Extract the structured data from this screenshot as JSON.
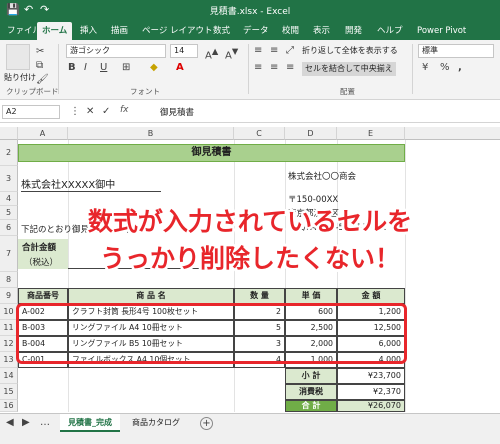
{
  "titlebar": {
    "title": "見積書.xlsx  -  Excel",
    "save_icon": "💾",
    "undo_icon": "↶",
    "redo_icon": "↷"
  },
  "menu": {
    "tabs": [
      "ファイル",
      "ホーム",
      "挿入",
      "描画",
      "ページ レイアウト",
      "数式",
      "データ",
      "校閲",
      "表示",
      "開発",
      "ヘルプ",
      "Power Pivot"
    ]
  },
  "ribbon": {
    "clipboard": {
      "paste_label": "貼り付け",
      "group_label": "クリップボード"
    },
    "font": {
      "font_name": "游ゴシック",
      "font_size": "14",
      "bold": "B",
      "italic": "I",
      "underline": "U",
      "group_label": "フォント"
    },
    "alignment": {
      "wrap_label": "折り返して全体を表示する",
      "merge_label": "セルを結合して中央揃え",
      "group_label": "配置"
    },
    "number": {
      "format_value": "標準",
      "percent": "%",
      "comma": ","
    }
  },
  "formula_bar": {
    "name_box": "A2",
    "fx": "fx",
    "content": "御見積書"
  },
  "columns": [
    "A",
    "B",
    "C",
    "D",
    "E"
  ],
  "rows": [
    "2",
    "3",
    "4",
    "5",
    "6",
    "7",
    "8",
    "9",
    "10",
    "11",
    "12",
    "13",
    "14",
    "15",
    "16"
  ],
  "sheet": {
    "title": "御見積書",
    "client": "株式会社XXXXX御中",
    "company": "株式会社〇〇商会",
    "postal": "〒150-00XX",
    "address": "東京都渋谷区",
    "tel": "TEL/FAX 03-5457-XXXX",
    "intro": "下記のとおり御見積申し上げます。",
    "total_label": "合計金額",
    "total_sub": "（税込）",
    "headers": [
      "商品番号",
      "商 品 名",
      "数 量",
      "単 価",
      "金 額"
    ],
    "items": [
      {
        "code": "A-002",
        "name": "クラフト封筒 長形4号 100枚セット",
        "qty": "2",
        "price": "600",
        "amount": "1,200"
      },
      {
        "code": "B-003",
        "name": "リングファイル A4 10冊セット",
        "qty": "5",
        "price": "2,500",
        "amount": "12,500"
      },
      {
        "code": "B-004",
        "name": "リングファイル B5 10冊セット",
        "qty": "3",
        "price": "2,000",
        "amount": "6,000"
      },
      {
        "code": "C-001",
        "name": "ファイルボックス A4 10個セット",
        "qty": "4",
        "price": "1,000",
        "amount": "4,000"
      }
    ],
    "subtotal_label": "小 計",
    "subtotal": "¥23,700",
    "tax_label": "消費税",
    "tax": "¥2,370",
    "grand_label": "合 計",
    "grand": "¥26,070"
  },
  "overlay": {
    "line1": "数式が入力されているセルを",
    "line2": "うっかり削除したくない！"
  },
  "sheet_tabs": [
    "見積書_完成",
    "商品カタログ"
  ],
  "add_sheet_icon": "+",
  "accent": "#217346",
  "highlight": "#e8262b"
}
